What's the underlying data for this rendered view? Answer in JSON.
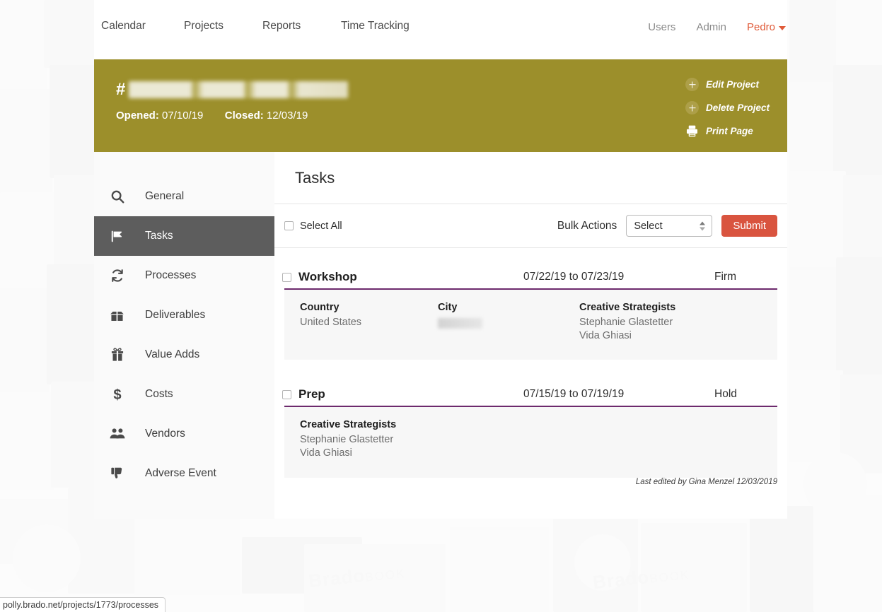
{
  "topnav": {
    "left_items": [
      {
        "label": "Calendar",
        "name": "nav-calendar"
      },
      {
        "label": "Projects",
        "name": "nav-projects"
      },
      {
        "label": "Reports",
        "name": "nav-reports"
      },
      {
        "label": "Time Tracking",
        "name": "nav-time-tracking"
      }
    ],
    "right_items": [
      {
        "label": "Users",
        "name": "nav-users"
      },
      {
        "label": "Admin",
        "name": "nav-admin"
      }
    ],
    "user": {
      "label": "Pedro",
      "icon": "caret-down-icon"
    }
  },
  "banner": {
    "hash": "#",
    "title_redacted": true,
    "opened_label": "Opened:",
    "opened_value": "07/10/19",
    "closed_label": "Closed:",
    "closed_value": "12/03/19",
    "actions": [
      {
        "label": "Edit Project",
        "icon": "plus-circle-icon",
        "name": "edit-project-link"
      },
      {
        "label": "Delete Project",
        "icon": "plus-circle-icon",
        "name": "delete-project-link"
      },
      {
        "label": "Print Page",
        "icon": "printer-icon",
        "name": "print-page-link"
      }
    ]
  },
  "sidebar": {
    "items": [
      {
        "label": "General",
        "icon": "magnifier-icon",
        "name": "sidebar-item-general",
        "active": false
      },
      {
        "label": "Tasks",
        "icon": "flag-icon",
        "name": "sidebar-item-tasks",
        "active": true
      },
      {
        "label": "Processes",
        "icon": "refresh-icon",
        "name": "sidebar-item-processes",
        "active": false
      },
      {
        "label": "Deliverables",
        "icon": "open-box-icon",
        "name": "sidebar-item-deliverables",
        "active": false
      },
      {
        "label": "Value Adds",
        "icon": "gift-icon",
        "name": "sidebar-item-value-adds",
        "active": false
      },
      {
        "label": "Costs",
        "icon": "dollar-icon",
        "name": "sidebar-item-costs",
        "active": false
      },
      {
        "label": "Vendors",
        "icon": "people-icon",
        "name": "sidebar-item-vendors",
        "active": false
      },
      {
        "label": "Adverse Event",
        "icon": "thumbs-down-icon",
        "name": "sidebar-item-adverse-event",
        "active": false
      }
    ]
  },
  "content": {
    "page_title": "Tasks",
    "select_all_label": "Select All",
    "bulk_actions_label": "Bulk Actions",
    "bulk_select_value": "Select",
    "submit_label": "Submit",
    "last_edited": "Last edited by Gina Menzel 12/03/2019",
    "tasks": [
      {
        "name": "Workshop",
        "dates": "07/22/19 to 07/23/19",
        "status": "Firm",
        "country_label": "Country",
        "country_value": "United States",
        "city_label": "City",
        "city_value_redacted": true,
        "strategists_label": "Creative Strategists",
        "strategists": [
          "Stephanie Glastetter",
          "Vida Ghiasi"
        ]
      },
      {
        "name": "Prep",
        "dates": "07/15/19 to 07/19/19",
        "status": "Hold",
        "strategists_label": "Creative Strategists",
        "strategists": [
          "Stephanie Glastetter",
          "Vida Ghiasi"
        ]
      }
    ]
  },
  "statusbar": {
    "url": "polly.brado.net/projects/1773/processes"
  },
  "colors": {
    "banner_gold": "#9c8f2b",
    "accent_coral": "#d9543f",
    "task_underline_purple": "#6d2a6d",
    "sidebar_active": "#5d5d5d"
  }
}
